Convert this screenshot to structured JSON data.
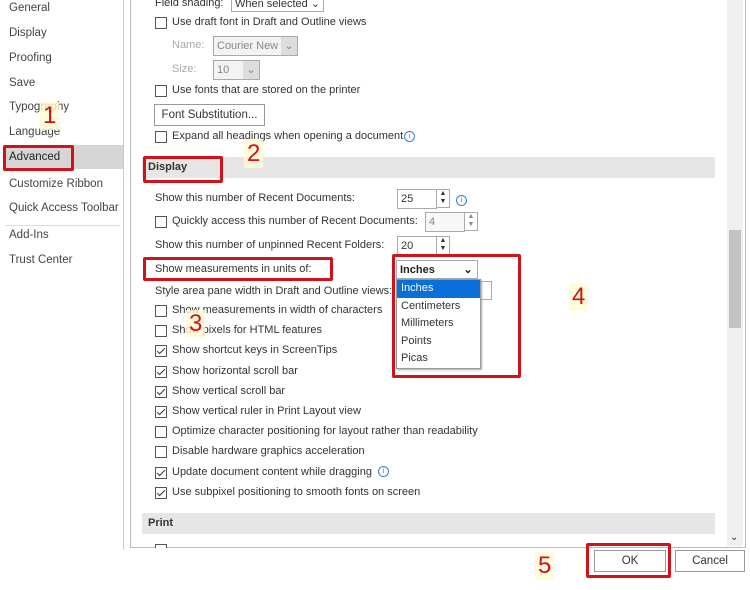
{
  "sidebar": {
    "items": [
      "General",
      "Display",
      "Proofing",
      "Save",
      "Typography",
      "Language",
      "Advanced",
      "Customize Ribbon",
      "Quick Access Toolbar",
      "Add-Ins",
      "Trust Center"
    ],
    "selected": "Advanced"
  },
  "top": {
    "field_shading_label": "Field shading:",
    "field_shading_value": "When selected",
    "draft_font": {
      "label": "Use draft font in Draft and Outline views",
      "checked": false
    },
    "name_label": "Name:",
    "name_value": "Courier New",
    "size_label": "Size:",
    "size_value": "10",
    "printer_fonts": {
      "label": "Use fonts that are stored on the printer",
      "checked": false
    },
    "font_substitution": "Font Substitution...",
    "expand_headings": {
      "label": "Expand all headings when opening a document",
      "checked": false
    }
  },
  "display": {
    "title": "Display",
    "recent_docs_label": "Show this number of Recent Documents:",
    "recent_docs_value": "25",
    "quick_access": {
      "label": "Quickly access this number of Recent Documents:",
      "checked": false,
      "value": "4"
    },
    "recent_folders_label": "Show this number of unpinned Recent Folders:",
    "recent_folders_value": "20",
    "units_label": "Show measurements in units of:",
    "units_value": "Inches",
    "units_options": [
      "Inches",
      "Centimeters",
      "Millimeters",
      "Points",
      "Picas"
    ],
    "style_area_label": "Style area pane width in Draft and Outline views:",
    "checks": [
      {
        "label": "Show measurements in width of characters",
        "checked": false
      },
      {
        "label": "Show pixels for HTML features",
        "checked": false
      },
      {
        "label": "Show shortcut keys in ScreenTips",
        "checked": true
      },
      {
        "label": "Show horizontal scroll bar",
        "checked": true
      },
      {
        "label": "Show vertical scroll bar",
        "checked": true
      },
      {
        "label": "Show vertical ruler in Print Layout view",
        "checked": true
      },
      {
        "label": "Optimize character positioning for layout rather than readability",
        "checked": false
      },
      {
        "label": "Disable hardware graphics acceleration",
        "checked": false
      },
      {
        "label": "Update document content while dragging",
        "checked": true
      },
      {
        "label": "Use subpixel positioning to smooth fonts on screen",
        "checked": true
      }
    ]
  },
  "print": {
    "title": "Print"
  },
  "footer": {
    "ok": "OK",
    "cancel": "Cancel"
  },
  "annotations": [
    "1",
    "2",
    "3",
    "4",
    "5"
  ],
  "colors": {
    "highlight_box": "#d0121a",
    "selected_option": "#0a6fd8"
  }
}
